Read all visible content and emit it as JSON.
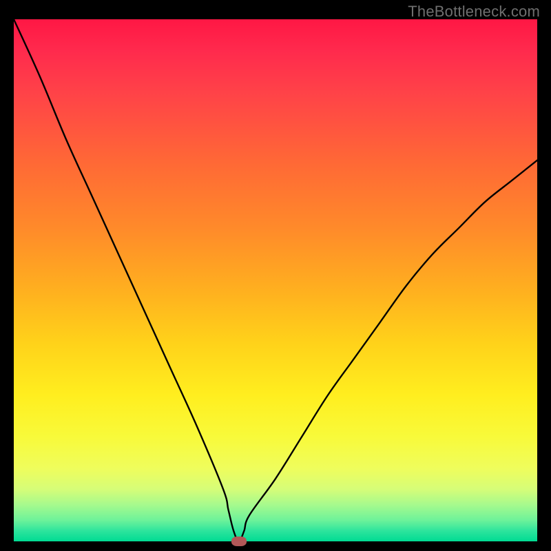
{
  "watermark": "TheBottleneck.com",
  "chart_data": {
    "type": "line",
    "title": "",
    "xlabel": "",
    "ylabel": "",
    "xlim": [
      0,
      100
    ],
    "ylim": [
      0,
      100
    ],
    "grid": false,
    "legend": false,
    "background": "rainbow-gradient-vertical",
    "series": [
      {
        "name": "bottleneck-curve",
        "x": [
          0,
          5,
          10,
          15,
          20,
          25,
          30,
          35,
          40,
          41,
          42,
          43,
          44,
          45,
          50,
          55,
          60,
          65,
          70,
          75,
          80,
          85,
          90,
          95,
          100
        ],
        "y": [
          100,
          89,
          77,
          66,
          55,
          44,
          33,
          22,
          10,
          6,
          2,
          0,
          2,
          5,
          12,
          20,
          28,
          35,
          42,
          49,
          55,
          60,
          65,
          69,
          73
        ]
      }
    ],
    "minimum_marker": {
      "x": 43,
      "y": 0,
      "color": "#b25858"
    },
    "gradient_stops": [
      {
        "pos": 0,
        "color": "#ff1744"
      },
      {
        "pos": 50,
        "color": "#ffd400"
      },
      {
        "pos": 100,
        "color": "#00db93"
      }
    ]
  }
}
